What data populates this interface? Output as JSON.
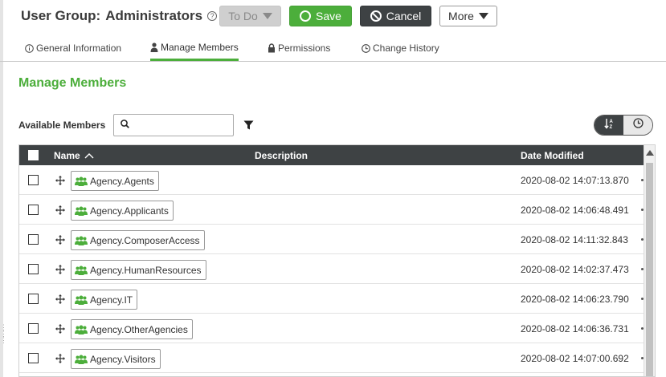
{
  "header": {
    "title_label": "User Group:",
    "title_value": "Administrators",
    "help_icon": "question-circle-icon"
  },
  "toolbar": {
    "todo_label": "To Do",
    "save_label": "Save",
    "cancel_label": "Cancel",
    "more_label": "More"
  },
  "tabs": [
    {
      "label": "General Information",
      "icon": "info-circle-icon"
    },
    {
      "label": "Manage Members",
      "icon": "user-icon",
      "active": true
    },
    {
      "label": "Permissions",
      "icon": "lock-icon"
    },
    {
      "label": "Change History",
      "icon": "clock-icon"
    }
  ],
  "section": {
    "title": "Manage Members"
  },
  "filter": {
    "available_label": "Available Members",
    "search_placeholder": "",
    "search_value": ""
  },
  "table": {
    "columns": {
      "name": "Name",
      "description": "Description",
      "date_modified": "Date Modified"
    },
    "rows": [
      {
        "name": "Agency.Agents",
        "description": "",
        "date": "2020-08-02 14:07:13.870"
      },
      {
        "name": "Agency.Applicants",
        "description": "",
        "date": "2020-08-02 14:06:48.491"
      },
      {
        "name": "Agency.ComposerAccess",
        "description": "",
        "date": "2020-08-02 14:11:32.843"
      },
      {
        "name": "Agency.HumanResources",
        "description": "",
        "date": "2020-08-02 14:02:37.473"
      },
      {
        "name": "Agency.IT",
        "description": "",
        "date": "2020-08-02 14:06:23.790"
      },
      {
        "name": "Agency.OtherAgencies",
        "description": "",
        "date": "2020-08-02 14:06:36.731"
      },
      {
        "name": "Agency.Visitors",
        "description": "",
        "date": "2020-08-02 14:07:00.692"
      }
    ]
  },
  "colors": {
    "accent_green": "#4cae3b",
    "dark_header": "#3e4244",
    "disabled_gray": "#cfcfcf"
  }
}
